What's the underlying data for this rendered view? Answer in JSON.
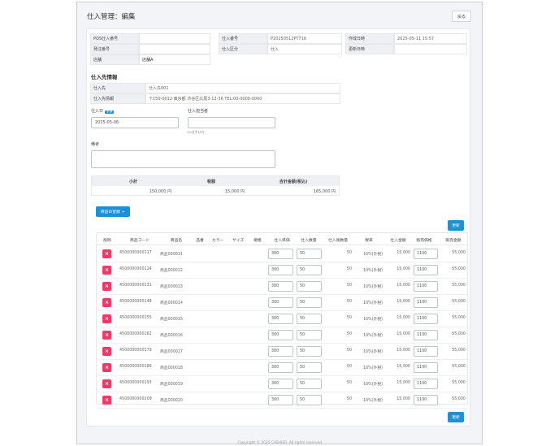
{
  "header": {
    "title": "仕入管理：編集",
    "back_label": "戻る"
  },
  "info": {
    "pos_no_label": "POS仕入番号",
    "pos_no": "",
    "order_no_label": "発注番号",
    "order_no": "",
    "store_label": "店舗",
    "store": "店舗A",
    "purchase_no_label": "仕入番号",
    "purchase_no": "P20250512PT716",
    "purchase_type_label": "仕入区分",
    "purchase_type": "仕入",
    "created_label": "作成日時",
    "created": "2025-05-11 15:57",
    "updated_label": "更新日時",
    "updated": ""
  },
  "supplier": {
    "section_title": "仕入先情報",
    "name_label": "仕入先",
    "name": "仕入先001",
    "info_label": "仕入先情報",
    "info": "〒150-0012 東京都 渋谷区広尾3-12-36 TEL:00-0000-0000"
  },
  "form": {
    "date_label": "仕入日",
    "required_badge": "必須",
    "date_value": "2025-05-06",
    "staff_label": "仕入担当者",
    "staff_value": "",
    "staff_hint": "20文字以内",
    "memo_label": "備考",
    "memo_value": ""
  },
  "summary": {
    "subtotal_label": "小計",
    "subtotal": "150,000 円",
    "tax_label": "税額",
    "tax": "15,000 円",
    "total_label": "合計金額(税込)",
    "total": "165,000 円"
  },
  "products": {
    "add_label": "商品の登録 ＋",
    "update_label": "更新",
    "delete_glyph": "×",
    "columns": [
      "削除",
      "商品コード",
      "商品名",
      "品番",
      "カラー",
      "サイズ",
      "規格",
      "仕入単価",
      "仕入数量",
      "仕入後数量",
      "税率",
      "仕入金額",
      "販売価格",
      "販売金額"
    ],
    "rows": [
      {
        "code": "4500000000117",
        "name": "商品000011",
        "unit": "300",
        "qty": "50",
        "after": "50",
        "tax": "10%(外税)",
        "amount": "15,000",
        "price": "1100",
        "sales": "55,000"
      },
      {
        "code": "4500000000124",
        "name": "商品000012",
        "unit": "300",
        "qty": "50",
        "after": "50",
        "tax": "10%(外税)",
        "amount": "15,000",
        "price": "1100",
        "sales": "55,000"
      },
      {
        "code": "4500000000131",
        "name": "商品000013",
        "unit": "300",
        "qty": "50",
        "after": "50",
        "tax": "10%(外税)",
        "amount": "15,000",
        "price": "1100",
        "sales": "55,000"
      },
      {
        "code": "4500000000148",
        "name": "商品000014",
        "unit": "300",
        "qty": "50",
        "after": "50",
        "tax": "10%(外税)",
        "amount": "15,000",
        "price": "1100",
        "sales": "55,000"
      },
      {
        "code": "4500000000155",
        "name": "商品000015",
        "unit": "300",
        "qty": "50",
        "after": "50",
        "tax": "10%(外税)",
        "amount": "15,000",
        "price": "1100",
        "sales": "55,000"
      },
      {
        "code": "4500000000162",
        "name": "商品000016",
        "unit": "300",
        "qty": "50",
        "after": "50",
        "tax": "10%(外税)",
        "amount": "15,000",
        "price": "1100",
        "sales": "55,000"
      },
      {
        "code": "4500000000179",
        "name": "商品000017",
        "unit": "300",
        "qty": "50",
        "after": "50",
        "tax": "10%(外税)",
        "amount": "15,000",
        "price": "1100",
        "sales": "55,000"
      },
      {
        "code": "4500000000186",
        "name": "商品000018",
        "unit": "300",
        "qty": "50",
        "after": "50",
        "tax": "10%(外税)",
        "amount": "15,000",
        "price": "1100",
        "sales": "55,000"
      },
      {
        "code": "4500000000193",
        "name": "商品000019",
        "unit": "300",
        "qty": "50",
        "after": "50",
        "tax": "10%(外税)",
        "amount": "15,000",
        "price": "1100",
        "sales": "55,000"
      },
      {
        "code": "4500000000209",
        "name": "商品000020",
        "unit": "300",
        "qty": "50",
        "after": "50",
        "tax": "10%(外税)",
        "amount": "15,000",
        "price": "1100",
        "sales": "55,000"
      }
    ]
  },
  "footer": "Copyright © 2025 CASHIER. All rights reserved.",
  "colors": {
    "accent": "#1a91d9",
    "danger": "#f0386b",
    "background": "#f3f4f7"
  }
}
